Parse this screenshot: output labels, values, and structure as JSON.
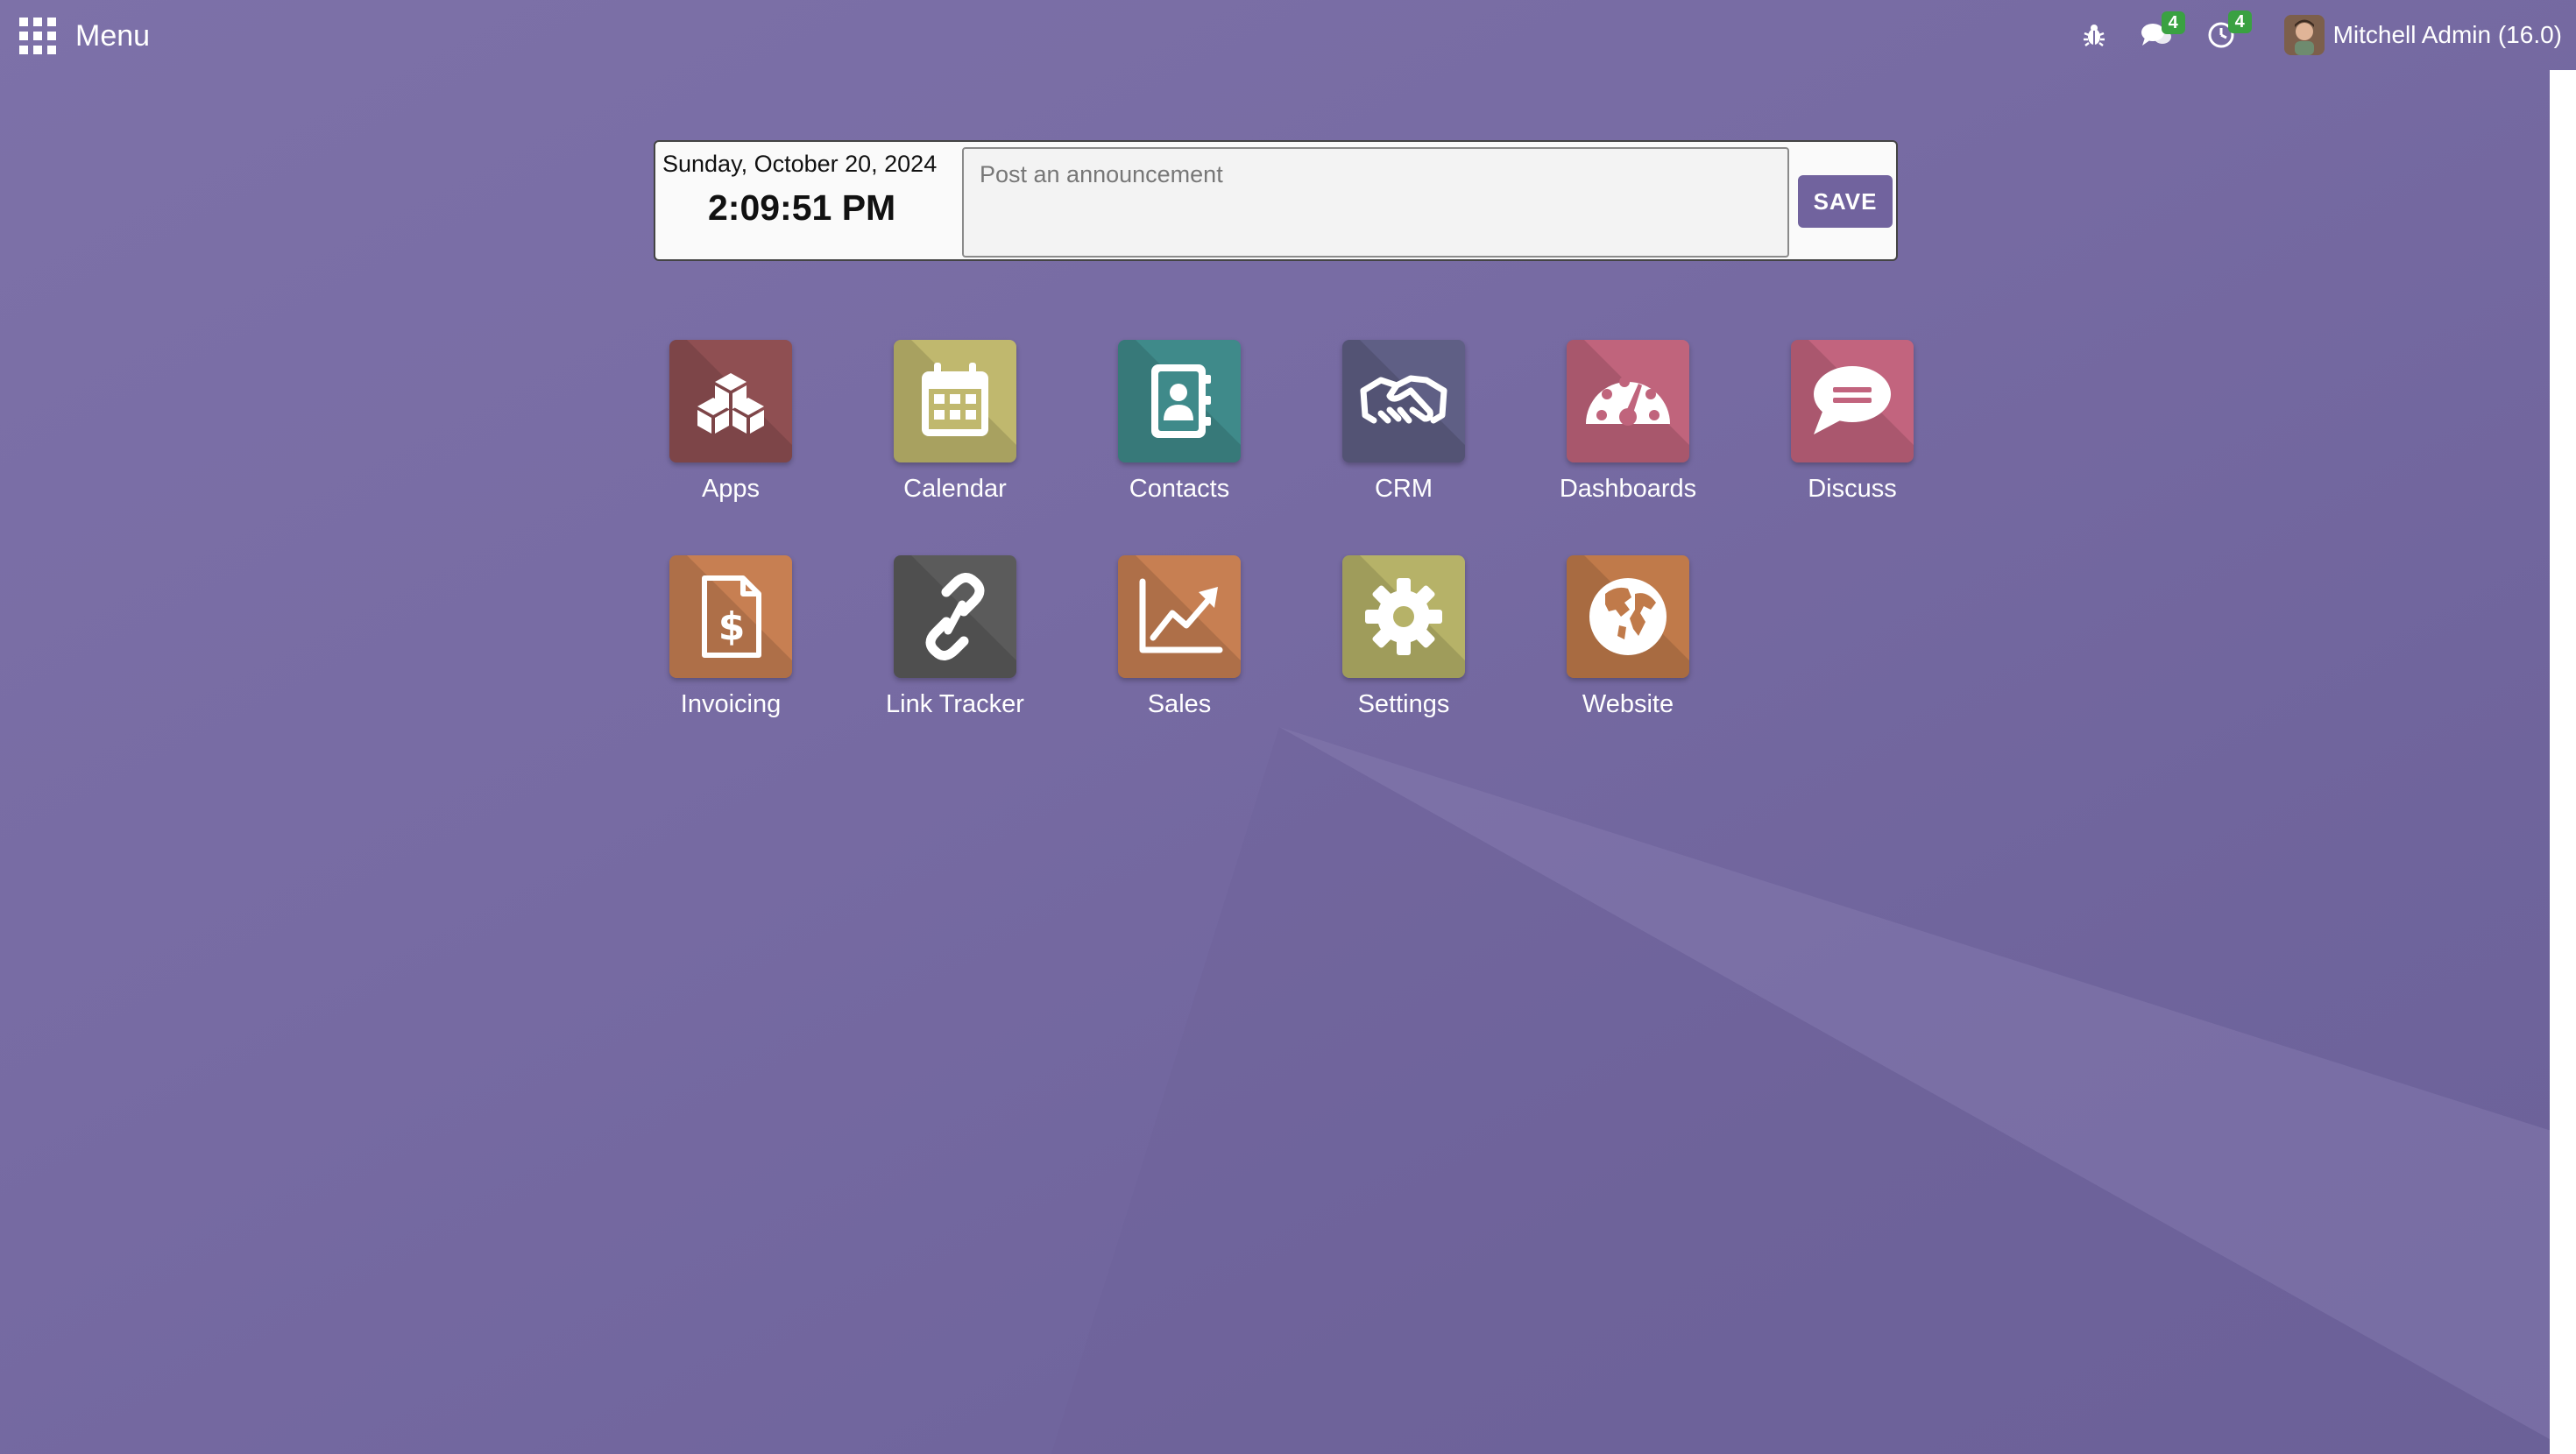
{
  "topbar": {
    "menu_label": "Menu",
    "user_name": "Mitchell Admin (16.0)",
    "messages_count": "4",
    "activities_count": "4"
  },
  "announcement": {
    "date": "Sunday, October 20, 2024",
    "time": "2:09:51 PM",
    "placeholder": "Post an announcement",
    "save_label": "SAVE"
  },
  "apps": [
    {
      "label": "Apps",
      "icon": "cubes-icon",
      "color": "#8f4f52"
    },
    {
      "label": "Calendar",
      "icon": "calendar-icon",
      "color": "#c0b86e"
    },
    {
      "label": "Contacts",
      "icon": "address-book-icon",
      "color": "#3f8a8a"
    },
    {
      "label": "CRM",
      "icon": "handshake-icon",
      "color": "#5f5f85"
    },
    {
      "label": "Dashboards",
      "icon": "tachometer-icon",
      "color": "#c0647c"
    },
    {
      "label": "Discuss",
      "icon": "comment-icon",
      "color": "#c2647e"
    },
    {
      "label": "Invoicing",
      "icon": "invoice-icon",
      "color": "#c77f52"
    },
    {
      "label": "Link Tracker",
      "icon": "link-icon",
      "color": "#5b5b5b"
    },
    {
      "label": "Sales",
      "icon": "chart-line-icon",
      "color": "#c77f52"
    },
    {
      "label": "Settings",
      "icon": "gear-icon",
      "color": "#b6b268"
    },
    {
      "label": "Website",
      "icon": "globe-icon",
      "color": "#c07a4a"
    }
  ],
  "colors": {
    "background": "#7a6ea6",
    "primary": "#71639e",
    "badge": "#3aa142"
  }
}
